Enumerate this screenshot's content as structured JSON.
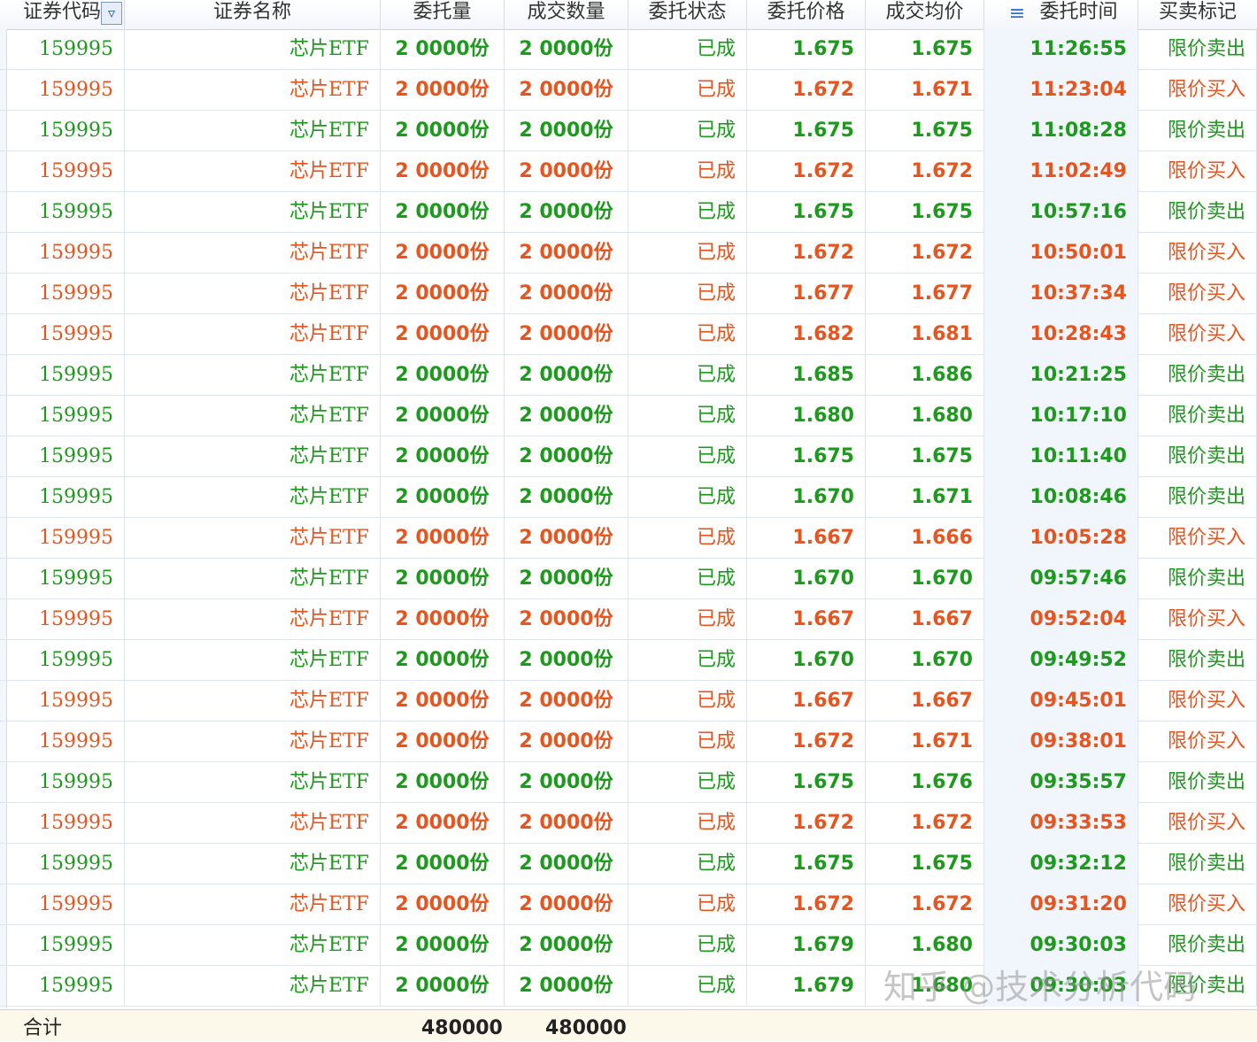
{
  "colors": {
    "buy": "#e8541d",
    "sell": "#1c9a1c",
    "header_text": "#333333",
    "footer_bg": "#fcf8ea"
  },
  "headers": [
    "证券代码",
    "证券名称",
    "委托量",
    "成交数量",
    "委托状态",
    "委托价格",
    "成交均价",
    "委托时间",
    "买卖标记"
  ],
  "header_icons": {
    "filter": "filter-icon",
    "sort": "sort-icon"
  },
  "rows": [
    {
      "code": "159995",
      "name": "芯片ETF",
      "order_qty": "2 0000份",
      "filled_qty": "2 0000份",
      "status": "已成",
      "order_price": "1.675",
      "avg_price": "1.675",
      "time": "11:26:55",
      "side": "限价卖出",
      "side_type": "sell"
    },
    {
      "code": "159995",
      "name": "芯片ETF",
      "order_qty": "2 0000份",
      "filled_qty": "2 0000份",
      "status": "已成",
      "order_price": "1.672",
      "avg_price": "1.671",
      "time": "11:23:04",
      "side": "限价买入",
      "side_type": "buy"
    },
    {
      "code": "159995",
      "name": "芯片ETF",
      "order_qty": "2 0000份",
      "filled_qty": "2 0000份",
      "status": "已成",
      "order_price": "1.675",
      "avg_price": "1.675",
      "time": "11:08:28",
      "side": "限价卖出",
      "side_type": "sell"
    },
    {
      "code": "159995",
      "name": "芯片ETF",
      "order_qty": "2 0000份",
      "filled_qty": "2 0000份",
      "status": "已成",
      "order_price": "1.672",
      "avg_price": "1.672",
      "time": "11:02:49",
      "side": "限价买入",
      "side_type": "buy"
    },
    {
      "code": "159995",
      "name": "芯片ETF",
      "order_qty": "2 0000份",
      "filled_qty": "2 0000份",
      "status": "已成",
      "order_price": "1.675",
      "avg_price": "1.675",
      "time": "10:57:16",
      "side": "限价卖出",
      "side_type": "sell"
    },
    {
      "code": "159995",
      "name": "芯片ETF",
      "order_qty": "2 0000份",
      "filled_qty": "2 0000份",
      "status": "已成",
      "order_price": "1.672",
      "avg_price": "1.672",
      "time": "10:50:01",
      "side": "限价买入",
      "side_type": "buy"
    },
    {
      "code": "159995",
      "name": "芯片ETF",
      "order_qty": "2 0000份",
      "filled_qty": "2 0000份",
      "status": "已成",
      "order_price": "1.677",
      "avg_price": "1.677",
      "time": "10:37:34",
      "side": "限价买入",
      "side_type": "buy"
    },
    {
      "code": "159995",
      "name": "芯片ETF",
      "order_qty": "2 0000份",
      "filled_qty": "2 0000份",
      "status": "已成",
      "order_price": "1.682",
      "avg_price": "1.681",
      "time": "10:28:43",
      "side": "限价买入",
      "side_type": "buy"
    },
    {
      "code": "159995",
      "name": "芯片ETF",
      "order_qty": "2 0000份",
      "filled_qty": "2 0000份",
      "status": "已成",
      "order_price": "1.685",
      "avg_price": "1.686",
      "time": "10:21:25",
      "side": "限价卖出",
      "side_type": "sell"
    },
    {
      "code": "159995",
      "name": "芯片ETF",
      "order_qty": "2 0000份",
      "filled_qty": "2 0000份",
      "status": "已成",
      "order_price": "1.680",
      "avg_price": "1.680",
      "time": "10:17:10",
      "side": "限价卖出",
      "side_type": "sell"
    },
    {
      "code": "159995",
      "name": "芯片ETF",
      "order_qty": "2 0000份",
      "filled_qty": "2 0000份",
      "status": "已成",
      "order_price": "1.675",
      "avg_price": "1.675",
      "time": "10:11:40",
      "side": "限价卖出",
      "side_type": "sell"
    },
    {
      "code": "159995",
      "name": "芯片ETF",
      "order_qty": "2 0000份",
      "filled_qty": "2 0000份",
      "status": "已成",
      "order_price": "1.670",
      "avg_price": "1.671",
      "time": "10:08:46",
      "side": "限价卖出",
      "side_type": "sell"
    },
    {
      "code": "159995",
      "name": "芯片ETF",
      "order_qty": "2 0000份",
      "filled_qty": "2 0000份",
      "status": "已成",
      "order_price": "1.667",
      "avg_price": "1.666",
      "time": "10:05:28",
      "side": "限价买入",
      "side_type": "buy"
    },
    {
      "code": "159995",
      "name": "芯片ETF",
      "order_qty": "2 0000份",
      "filled_qty": "2 0000份",
      "status": "已成",
      "order_price": "1.670",
      "avg_price": "1.670",
      "time": "09:57:46",
      "side": "限价卖出",
      "side_type": "sell"
    },
    {
      "code": "159995",
      "name": "芯片ETF",
      "order_qty": "2 0000份",
      "filled_qty": "2 0000份",
      "status": "已成",
      "order_price": "1.667",
      "avg_price": "1.667",
      "time": "09:52:04",
      "side": "限价买入",
      "side_type": "buy"
    },
    {
      "code": "159995",
      "name": "芯片ETF",
      "order_qty": "2 0000份",
      "filled_qty": "2 0000份",
      "status": "已成",
      "order_price": "1.670",
      "avg_price": "1.670",
      "time": "09:49:52",
      "side": "限价卖出",
      "side_type": "sell"
    },
    {
      "code": "159995",
      "name": "芯片ETF",
      "order_qty": "2 0000份",
      "filled_qty": "2 0000份",
      "status": "已成",
      "order_price": "1.667",
      "avg_price": "1.667",
      "time": "09:45:01",
      "side": "限价买入",
      "side_type": "buy"
    },
    {
      "code": "159995",
      "name": "芯片ETF",
      "order_qty": "2 0000份",
      "filled_qty": "2 0000份",
      "status": "已成",
      "order_price": "1.672",
      "avg_price": "1.671",
      "time": "09:38:01",
      "side": "限价买入",
      "side_type": "buy"
    },
    {
      "code": "159995",
      "name": "芯片ETF",
      "order_qty": "2 0000份",
      "filled_qty": "2 0000份",
      "status": "已成",
      "order_price": "1.675",
      "avg_price": "1.676",
      "time": "09:35:57",
      "side": "限价卖出",
      "side_type": "sell"
    },
    {
      "code": "159995",
      "name": "芯片ETF",
      "order_qty": "2 0000份",
      "filled_qty": "2 0000份",
      "status": "已成",
      "order_price": "1.672",
      "avg_price": "1.672",
      "time": "09:33:53",
      "side": "限价买入",
      "side_type": "buy"
    },
    {
      "code": "159995",
      "name": "芯片ETF",
      "order_qty": "2 0000份",
      "filled_qty": "2 0000份",
      "status": "已成",
      "order_price": "1.675",
      "avg_price": "1.675",
      "time": "09:32:12",
      "side": "限价卖出",
      "side_type": "sell"
    },
    {
      "code": "159995",
      "name": "芯片ETF",
      "order_qty": "2 0000份",
      "filled_qty": "2 0000份",
      "status": "已成",
      "order_price": "1.672",
      "avg_price": "1.672",
      "time": "09:31:20",
      "side": "限价买入",
      "side_type": "buy"
    },
    {
      "code": "159995",
      "name": "芯片ETF",
      "order_qty": "2 0000份",
      "filled_qty": "2 0000份",
      "status": "已成",
      "order_price": "1.679",
      "avg_price": "1.680",
      "time": "09:30:03",
      "side": "限价卖出",
      "side_type": "sell"
    },
    {
      "code": "159995",
      "name": "芯片ETF",
      "order_qty": "2 0000份",
      "filled_qty": "2 0000份",
      "status": "已成",
      "order_price": "1.679",
      "avg_price": "1.680",
      "time": "09:30:03",
      "side": "限价卖出",
      "side_type": "sell"
    }
  ],
  "footer": {
    "label": "合计",
    "order_qty_total": "480000",
    "filled_qty_total": "480000"
  },
  "watermark": "知乎 @技术分析代码"
}
